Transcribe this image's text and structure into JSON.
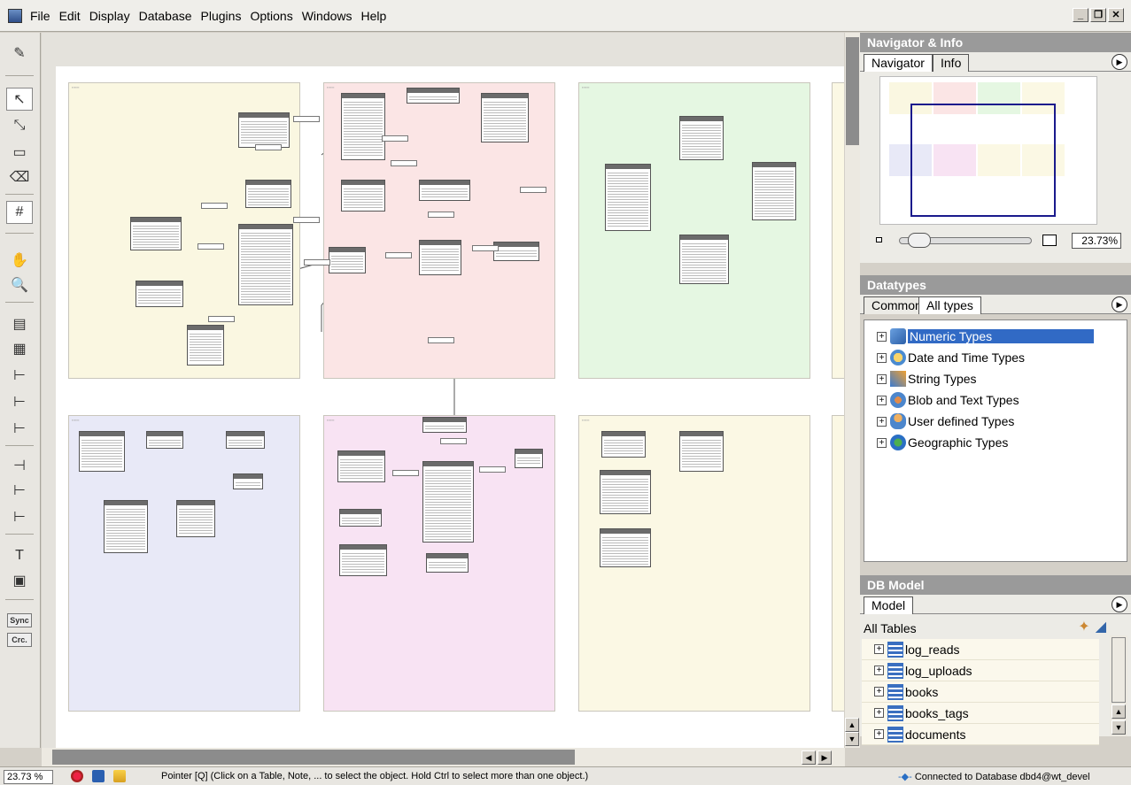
{
  "menu": {
    "items": [
      "File",
      "Edit",
      "Display",
      "Database",
      "Plugins",
      "Options",
      "Windows",
      "Help"
    ]
  },
  "window_buttons": [
    "_",
    "❐",
    "✕"
  ],
  "toolbar": {
    "sync_label": "Sync",
    "crc_label": "Crc."
  },
  "navigator": {
    "title": "Navigator & Info",
    "tabs": [
      "Navigator",
      "Info"
    ],
    "zoom_value": "23.73%"
  },
  "datatypes": {
    "title": "Datatypes",
    "tabs": [
      "Common",
      "All types"
    ],
    "items": [
      "Numeric Types",
      "Date and Time Types",
      "String Types",
      "Blob and Text Types",
      "User defined Types",
      "Geographic Types"
    ],
    "selected": "Numeric Types"
  },
  "db_model": {
    "title": "DB Model",
    "tabs": [
      "Model"
    ],
    "all_tables_label": "All Tables",
    "tables": [
      "log_reads",
      "log_uploads",
      "books",
      "books_tags",
      "documents"
    ]
  },
  "status": {
    "zoom": "23.73 %",
    "message": "Pointer [Q] (Click on a Table, Note, ... to select the object. Hold Ctrl to select more than one object.)",
    "connection": "Connected to Database dbd4@wt_devel"
  },
  "colors": {
    "region_yellow": "#faf7e1",
    "region_pink": "#fbe5e5",
    "region_green": "#e5f7e2",
    "region_blue": "#e8e9f7",
    "region_magenta": "#f8e3f3",
    "region_cream": "#fbf8e4",
    "selection": "#316ac5"
  }
}
